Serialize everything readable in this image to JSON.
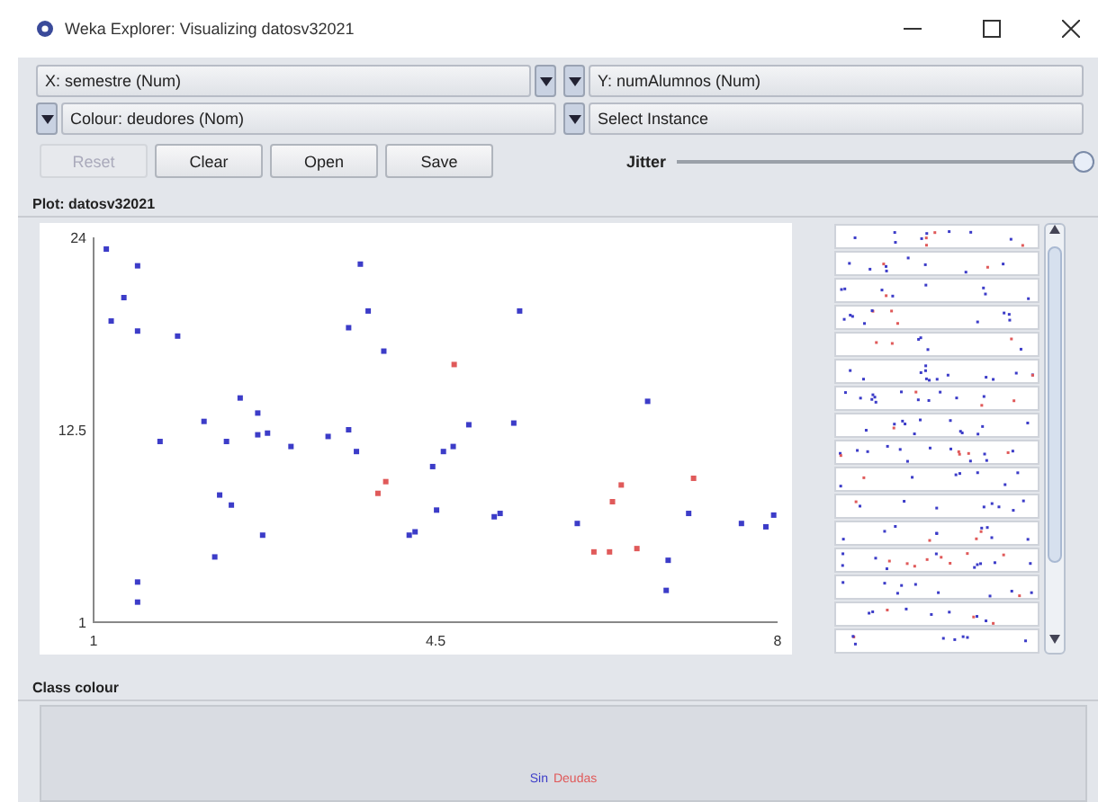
{
  "window": {
    "title": "Weka Explorer: Visualizing datosv32021"
  },
  "selectors": [
    {
      "kind": "x",
      "text": "X: semestre (Num)"
    },
    {
      "kind": "y",
      "text": "Y: numAlumnos (Num)"
    },
    {
      "kind": "colour",
      "text": "Colour: deudores (Nom)"
    },
    {
      "kind": "instance",
      "text": "Select Instance"
    }
  ],
  "buttons": [
    {
      "label": "Reset",
      "disabled": true
    },
    {
      "label": "Clear",
      "disabled": false
    },
    {
      "label": "Open",
      "disabled": false
    },
    {
      "label": "Save",
      "disabled": false
    }
  ],
  "jitter": {
    "label": "Jitter",
    "level": 1
  },
  "plot": {
    "title": "Plot: datosv32021",
    "chart_data": {
      "type": "scatter",
      "xlim": [
        1,
        8
      ],
      "ylim": [
        1,
        24
      ],
      "xticks": [
        {
          "value": 1,
          "label": "1"
        },
        {
          "value": 4.5,
          "label": "4.5"
        },
        {
          "value": 8,
          "label": "8"
        }
      ],
      "yticks": [
        {
          "value": 1,
          "label": "1"
        },
        {
          "value": 12.5,
          "label": "12.5"
        },
        {
          "value": 24,
          "label": "24"
        }
      ],
      "series": [
        {
          "name": "Sin",
          "color": "#3c3cc8",
          "x": [
            1.13,
            1.18,
            1.31,
            1.45,
            1.45,
            1.86,
            1.68,
            2.13,
            2.24,
            2.29,
            2.36,
            2.41,
            2.5,
            2.68,
            2.68,
            2.78,
            2.73,
            3.02,
            3.4,
            3.61,
            3.61,
            3.69,
            3.73,
            3.81,
            3.97,
            4.23,
            4.29,
            4.47,
            4.51,
            4.58,
            4.68,
            4.84,
            5.1,
            5.16,
            5.3,
            5.36,
            5.95,
            6.67,
            6.88,
            6.86,
            7.09,
            7.63,
            7.88,
            7.96,
            1.45,
            1.45
          ],
          "values": [
            23.3,
            19.0,
            20.4,
            22.3,
            18.4,
            18.1,
            11.8,
            13.0,
            4.9,
            8.6,
            11.8,
            8.0,
            14.4,
            13.5,
            12.2,
            12.3,
            6.2,
            11.5,
            12.1,
            12.5,
            18.6,
            11.2,
            22.4,
            19.6,
            17.2,
            6.2,
            6.4,
            10.3,
            7.7,
            11.2,
            11.5,
            12.8,
            7.3,
            7.5,
            12.9,
            19.6,
            6.9,
            14.2,
            4.7,
            2.9,
            7.5,
            6.9,
            6.7,
            7.4,
            3.4,
            2.2
          ]
        },
        {
          "name": "Deudas",
          "color": "#e05a5a",
          "x": [
            3.91,
            3.99,
            4.69,
            6.12,
            6.28,
            6.31,
            6.4,
            6.56,
            7.14
          ],
          "values": [
            8.7,
            9.4,
            16.4,
            5.2,
            5.2,
            8.2,
            9.2,
            5.4,
            9.6
          ]
        }
      ]
    }
  },
  "class_colour": {
    "title": "Class colour"
  }
}
